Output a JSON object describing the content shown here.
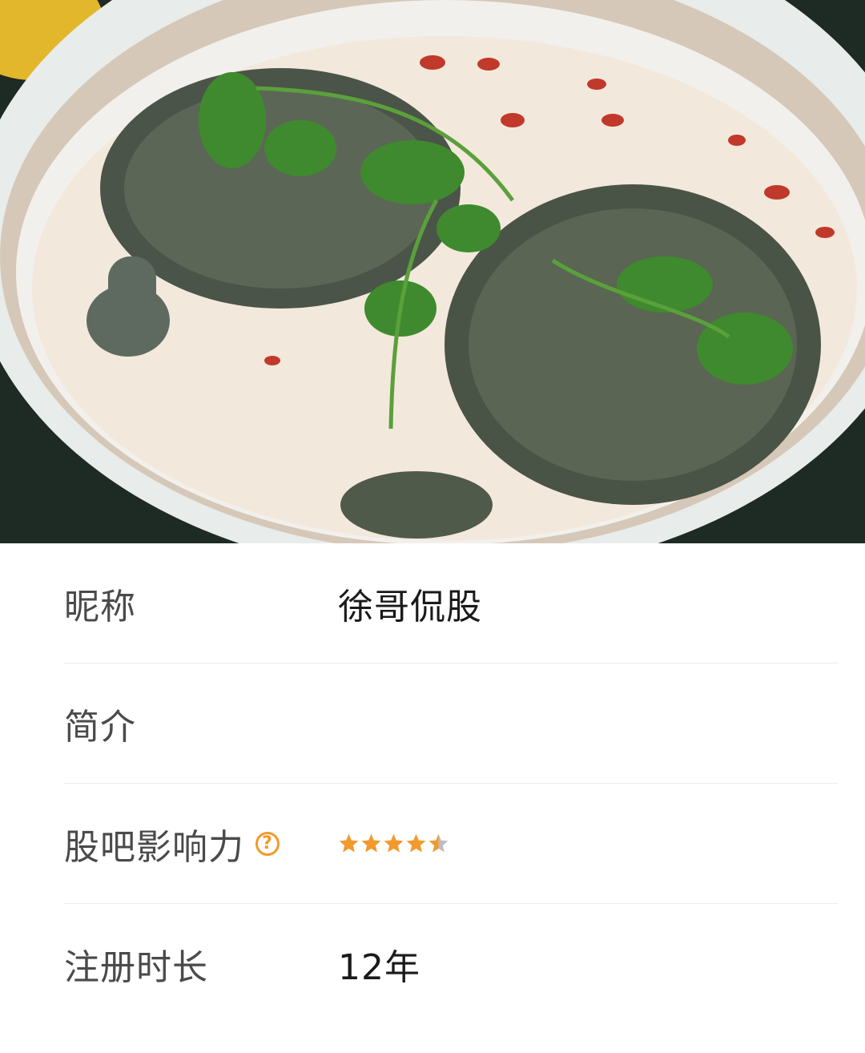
{
  "cover": {
    "image_icon": "soft-shell-turtle-soup-photo"
  },
  "profile": {
    "nickname_label": "昵称",
    "nickname_value": "徐哥侃股",
    "bio_label": "简介",
    "bio_value": "",
    "influence_label": "股吧影响力",
    "influence_help_icon": "question-circle-icon",
    "influence_rating": 4.5,
    "influence_rating_max": 5,
    "register_label": "注册时长",
    "register_value": "12年"
  },
  "colors": {
    "star_active": "#f39a2a",
    "star_inactive": "#bdbdbd",
    "accent": "#f39a2a"
  }
}
